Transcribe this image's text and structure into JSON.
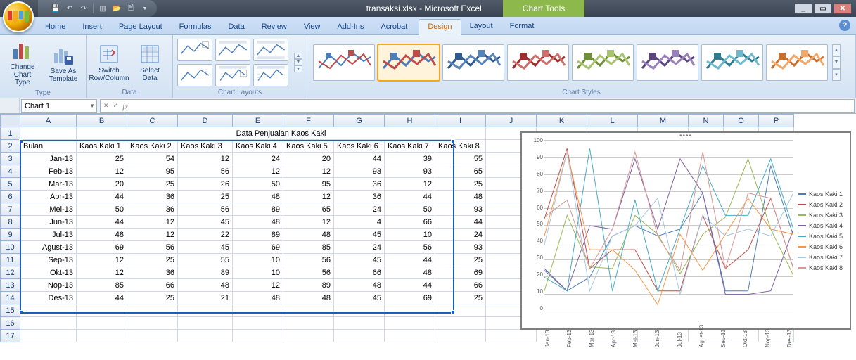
{
  "title": {
    "filename": "transaksi.xlsx",
    "app": "Microsoft Excel",
    "context_tab": "Chart Tools"
  },
  "ribbon": {
    "tabs": [
      "Home",
      "Insert",
      "Page Layout",
      "Formulas",
      "Data",
      "Review",
      "View",
      "Add-Ins",
      "Acrobat"
    ],
    "ctx_tabs": [
      "Design",
      "Layout",
      "Format"
    ],
    "active": "Design",
    "groups": {
      "type": {
        "label": "Type",
        "change": "Change Chart Type",
        "save": "Save As Template"
      },
      "data": {
        "label": "Data",
        "switch": "Switch Row/Column",
        "select": "Select Data"
      },
      "layouts": {
        "label": "Chart Layouts"
      },
      "styles": {
        "label": "Chart Styles"
      }
    }
  },
  "namebox": "Chart 1",
  "sheet": {
    "title": "Data Penjualan Kaos Kaki",
    "cols": [
      "A",
      "B",
      "C",
      "D",
      "E",
      "F",
      "G",
      "H",
      "I",
      "J",
      "K",
      "L",
      "M",
      "N",
      "O",
      "P"
    ],
    "header_row": [
      "Bulan",
      "Kaos Kaki 1",
      "Kaos Kaki 2",
      "Kaos Kaki 3",
      "Kaos Kaki 4",
      "Kaos Kaki 5",
      "Kaos Kaki 6",
      "Kaos Kaki 7",
      "Kaos Kaki 8"
    ],
    "months": [
      "Jan-13",
      "Feb-13",
      "Mar-13",
      "Apr-13",
      "Mei-13",
      "Jun-13",
      "Jul-13",
      "Agust-13",
      "Sep-13",
      "Okt-13",
      "Nop-13",
      "Des-13"
    ]
  },
  "chart_data": {
    "type": "line",
    "categories": [
      "Jan-13",
      "Feb-13",
      "Mar-13",
      "Apr-13",
      "Mei-13",
      "Jun-13",
      "Jul-13",
      "Agust-13",
      "Sep-13",
      "Okt-13",
      "Nop-13",
      "Des-13"
    ],
    "series": [
      {
        "name": "Kaos Kaki 1",
        "color": "#4a7ebb",
        "values": [
          25,
          12,
          20,
          44,
          50,
          44,
          48,
          69,
          12,
          12,
          85,
          44
        ]
      },
      {
        "name": "Kaos Kaki 2",
        "color": "#be4b48",
        "values": [
          54,
          95,
          25,
          36,
          36,
          12,
          12,
          56,
          25,
          36,
          66,
          25
        ]
      },
      {
        "name": "Kaos Kaki 3",
        "color": "#98b954",
        "values": [
          12,
          56,
          26,
          25,
          56,
          45,
          22,
          45,
          55,
          89,
          48,
          21
        ]
      },
      {
        "name": "Kaos Kaki 4",
        "color": "#7d60a0",
        "values": [
          24,
          12,
          50,
          48,
          89,
          48,
          89,
          69,
          10,
          10,
          12,
          48
        ]
      },
      {
        "name": "Kaos Kaki 5",
        "color": "#46aac5",
        "values": [
          20,
          12,
          95,
          12,
          65,
          12,
          48,
          85,
          56,
          56,
          89,
          48
        ]
      },
      {
        "name": "Kaos Kaki 6",
        "color": "#f79646",
        "values": [
          44,
          93,
          36,
          36,
          24,
          4,
          45,
          24,
          45,
          66,
          48,
          45
        ]
      },
      {
        "name": "Kaos Kaki 7",
        "color": "#A6C8E2",
        "values": [
          39,
          93,
          12,
          44,
          50,
          66,
          10,
          56,
          44,
          48,
          44,
          69
        ]
      },
      {
        "name": "Kaos Kaki 8",
        "color": "#d99694",
        "values": [
          55,
          65,
          25,
          48,
          93,
          44,
          24,
          93,
          25,
          69,
          66,
          25
        ]
      }
    ],
    "ylim": [
      0,
      100
    ],
    "yticks": [
      0,
      10,
      20,
      30,
      40,
      50,
      60,
      70,
      80,
      90,
      100
    ]
  }
}
